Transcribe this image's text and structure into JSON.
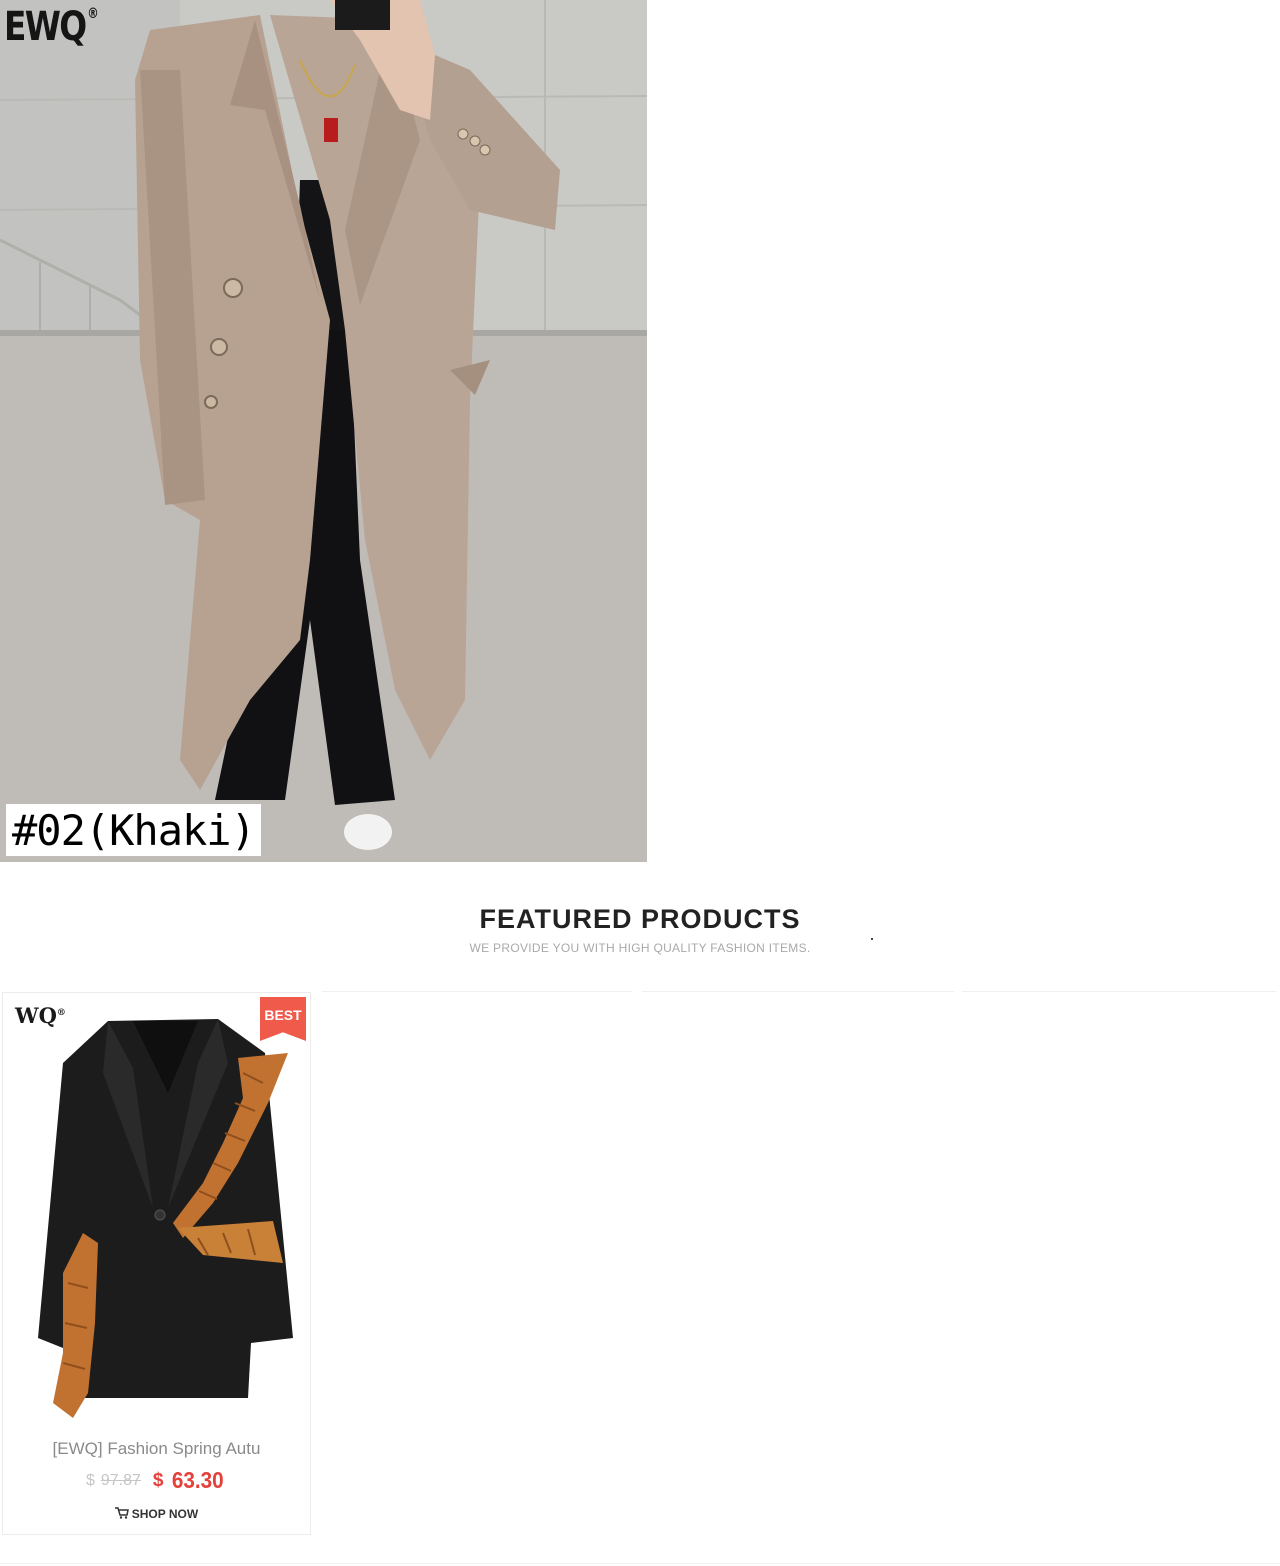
{
  "hero": {
    "brand": "EWQ",
    "brand_mark": "®",
    "variant_label": "#02(Khaki)"
  },
  "featured": {
    "title": "FEATURED PRODUCTS",
    "subtitle": "WE PROVIDE YOU WITH HIGH QUALITY FASHION ITEMS."
  },
  "products": [
    {
      "logo": "WQ",
      "logo_mark": "®",
      "badge": "BEST",
      "name": "[EWQ] Fashion Spring Autu",
      "currency": "$",
      "old_price": "97.87",
      "new_price": "63.30",
      "cta": "SHOP NOW",
      "cta_icon": "cart-icon"
    }
  ],
  "colors": {
    "price_red": "#e4413b",
    "badge_red": "#f05a4a",
    "coat_khaki": "#b7a292",
    "ruffle_orange": "#c27230"
  }
}
